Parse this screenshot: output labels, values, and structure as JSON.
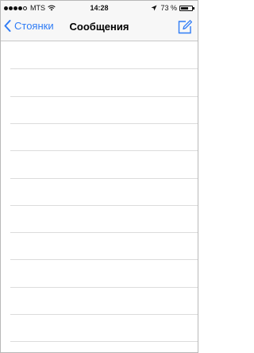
{
  "status_bar": {
    "carrier": "MTS",
    "time": "14:28",
    "battery_percent": "73 %",
    "battery_level": 0.73,
    "signal_strength": 4,
    "signal_max": 5
  },
  "nav": {
    "back_label": "Стоянки",
    "title": "Сообщения"
  },
  "colors": {
    "accent": "#2f7cf6"
  },
  "icons": {
    "back": "chevron-left-icon",
    "compose": "compose-icon",
    "wifi": "wifi-icon",
    "location": "location-arrow-icon",
    "battery": "battery-icon"
  },
  "list": {
    "row_count": 11
  }
}
